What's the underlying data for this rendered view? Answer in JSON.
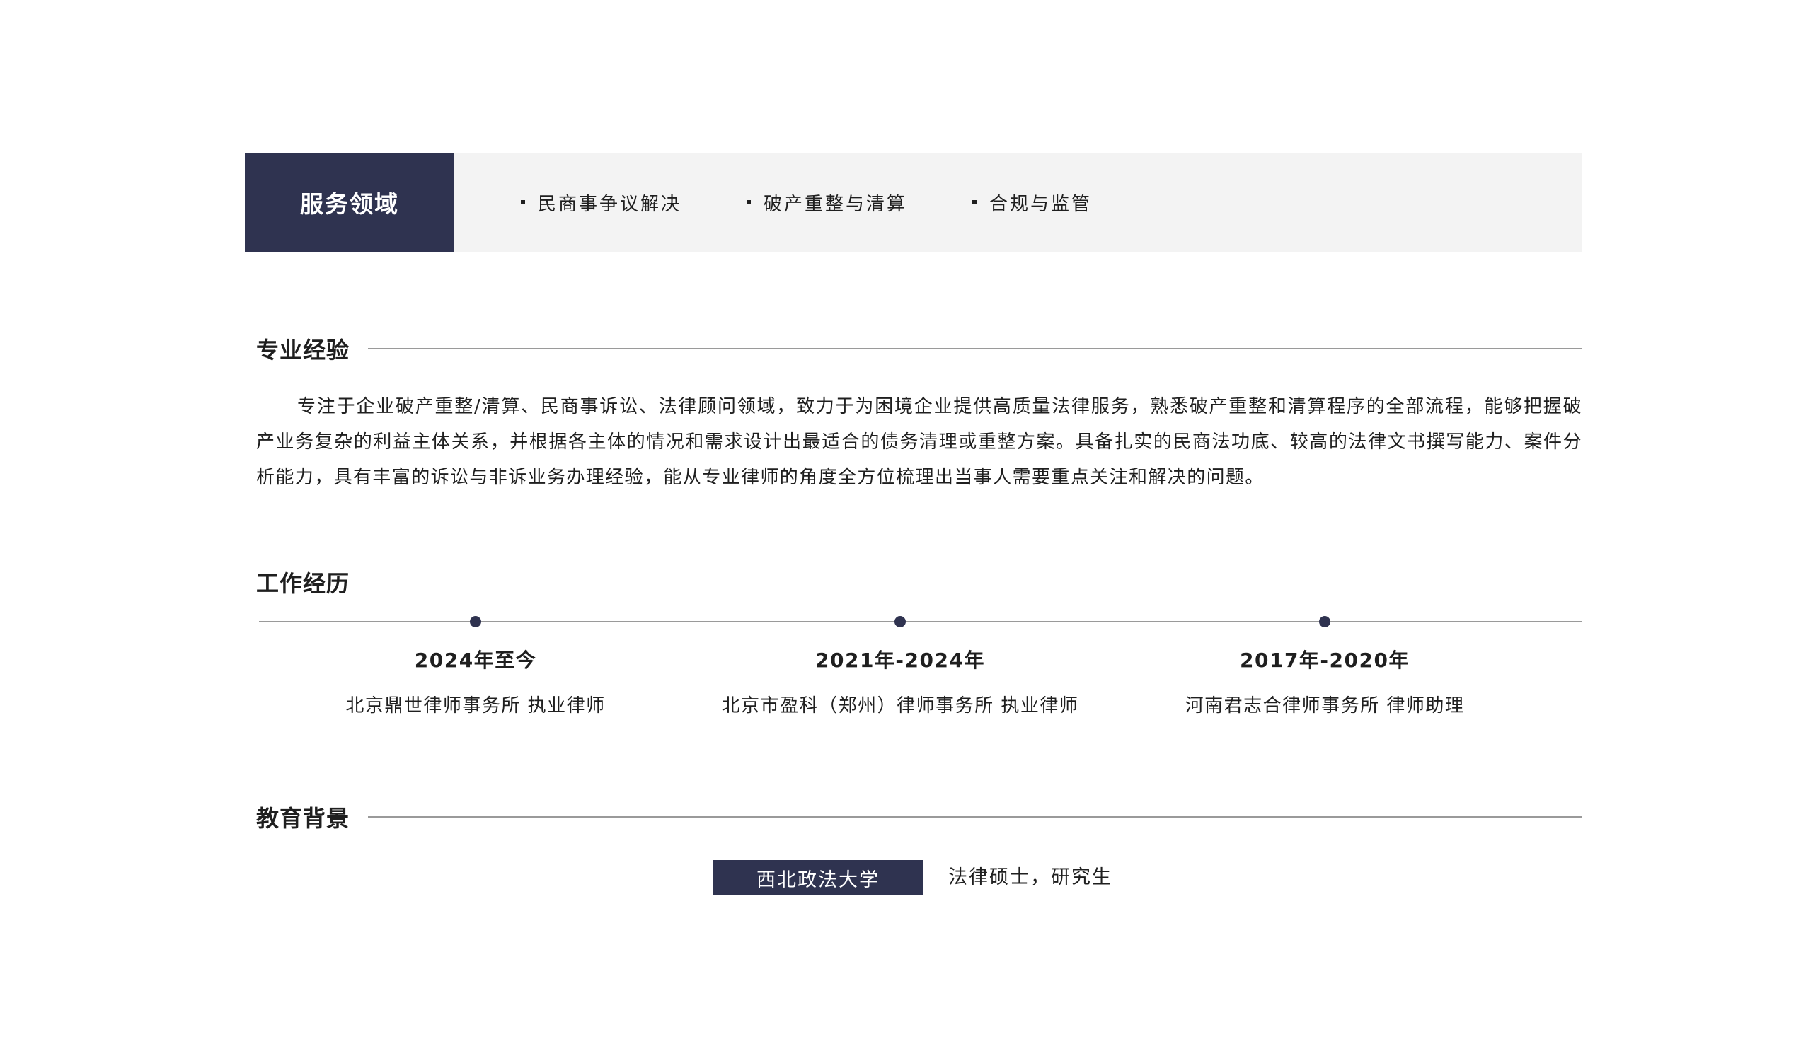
{
  "services": {
    "label": "服务领域",
    "items": [
      {
        "label": "民商事争议解决"
      },
      {
        "label": "破产重整与清算"
      },
      {
        "label": "合规与监管"
      }
    ]
  },
  "experience": {
    "heading": "专业经验",
    "text": "专注于企业破产重整/清算、民商事诉讼、法律顾问领域，致力于为困境企业提供高质量法律服务，熟悉破产重整和清算程序的全部流程，能够把握破产业务复杂的利益主体关系，并根据各主体的情况和需求设计出最适合的债务清理或重整方案。具备扎实的民商法功底、较高的法律文书撰写能力、案件分析能力，具有丰富的诉讼与非诉业务办理经验，能从专业律师的角度全方位梳理出当事人需要重点关注和解决的问题。"
  },
  "work": {
    "heading": "工作经历",
    "entries": [
      {
        "period": "2024年至今",
        "org": "北京鼎世律师事务所  执业律师"
      },
      {
        "period": "2021年-2024年",
        "org": "北京市盈科（郑州）律师事务所  执业律师"
      },
      {
        "period": "2017年-2020年",
        "org": "河南君志合律师事务所  律师助理"
      }
    ]
  },
  "education": {
    "heading": "教育背景",
    "school": "西北政法大学",
    "degree": "法律硕士，研究生"
  },
  "colors": {
    "accent": "#2f3350",
    "band_background": "#f3f3f3",
    "rule": "#9a9a9a",
    "text": "#1f1f1f"
  }
}
